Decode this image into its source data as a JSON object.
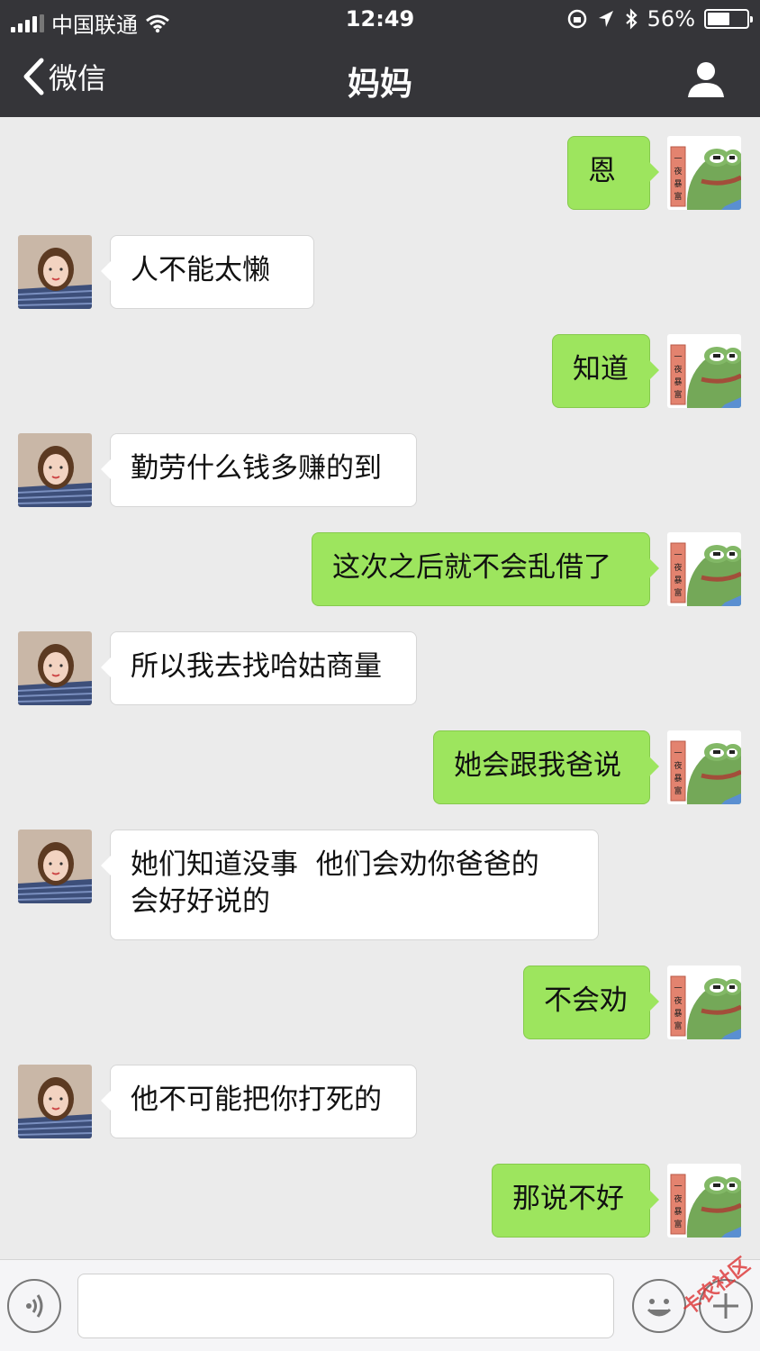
{
  "status": {
    "carrier": "中国联通",
    "time": "12:49",
    "battery": "56%",
    "battery_level": 0.56
  },
  "nav": {
    "back_label": "微信",
    "title": "妈妈"
  },
  "messages": [
    {
      "side": "out",
      "text": "恩"
    },
    {
      "side": "in",
      "text": "人不能太懒"
    },
    {
      "side": "out",
      "text": "知道"
    },
    {
      "side": "in",
      "text": "勤劳什么钱多赚的到"
    },
    {
      "side": "out",
      "text": "这次之后就不会乱借了"
    },
    {
      "side": "in",
      "text": "所以我去找哈姑商量"
    },
    {
      "side": "out",
      "text": "她会跟我爸说"
    },
    {
      "side": "in",
      "text": "她们知道没事  他们会劝你爸爸的\n会好好说的"
    },
    {
      "side": "out",
      "text": "不会劝"
    },
    {
      "side": "in",
      "text": "他不可能把你打死的"
    },
    {
      "side": "out",
      "text": "那说不好"
    }
  ],
  "sticker_text": "一夜暴富",
  "watermark": "卡农社区",
  "colors": {
    "nav_bg": "#353539",
    "bubble_out": "#9de55e",
    "bubble_in": "#ffffff",
    "chat_bg": "#ebebeb"
  }
}
